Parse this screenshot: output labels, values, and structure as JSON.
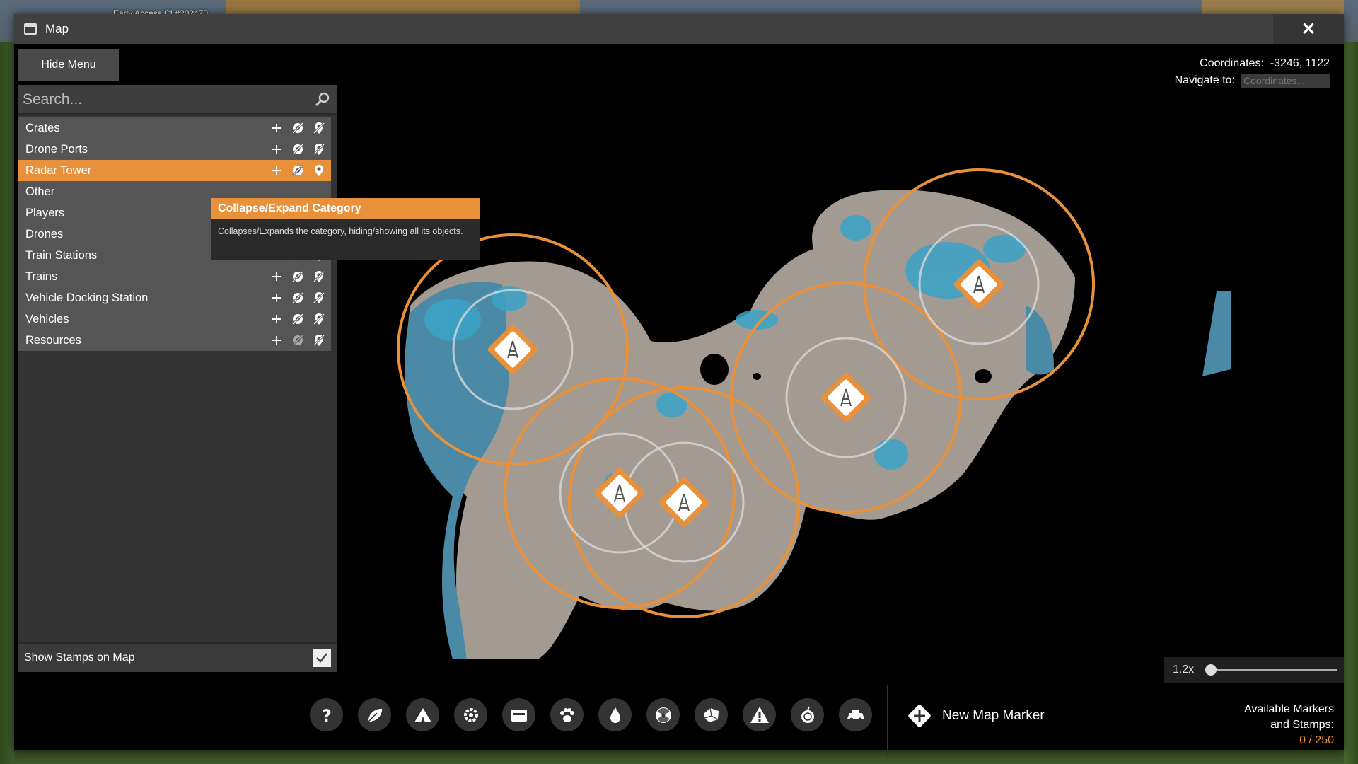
{
  "build_tag": "Early Access CL#202470",
  "window": {
    "title": "Map",
    "close_glyph": "✕"
  },
  "hide_menu_label": "Hide Menu",
  "search": {
    "placeholder": "Search..."
  },
  "categories": [
    {
      "label": "Crates",
      "active": false
    },
    {
      "label": "Drone Ports",
      "active": false
    },
    {
      "label": "Radar Tower",
      "active": true
    },
    {
      "label": "Other",
      "active": false
    },
    {
      "label": "Players",
      "active": false
    },
    {
      "label": "Drones",
      "active": false
    },
    {
      "label": "Train Stations",
      "active": false
    },
    {
      "label": "Trains",
      "active": false
    },
    {
      "label": "Vehicle Docking Station",
      "active": false
    },
    {
      "label": "Vehicles",
      "active": false
    },
    {
      "label": "Resources",
      "active": false
    }
  ],
  "tooltip": {
    "title": "Collapse/Expand Category",
    "body": "Collapses/Expands the category, hiding/showing all its objects."
  },
  "show_stamps": {
    "label": "Show Stamps on Map",
    "checked": true
  },
  "coordinates": {
    "label": "Coordinates:",
    "value": "-3246, 1122"
  },
  "navigate": {
    "label": "Navigate to:",
    "placeholder": "Coordinates..."
  },
  "zoom": {
    "value": "1.2x",
    "level": 0.0
  },
  "stamps": [
    "question-icon",
    "leaf-icon",
    "camp-icon",
    "gear-icon",
    "crate-icon",
    "paw-icon",
    "water-drop-icon",
    "radiation-icon",
    "ore-icon",
    "warning-icon",
    "fruit-icon",
    "vehicle-icon"
  ],
  "new_marker_label": "New Map Marker",
  "available": {
    "line1": "Available Markers",
    "line2": "and Stamps:",
    "count": "0 / 250"
  },
  "colors": {
    "accent": "#e8913a",
    "water": "#3aa3c8",
    "land": "#a19890"
  },
  "radar_towers": 5
}
